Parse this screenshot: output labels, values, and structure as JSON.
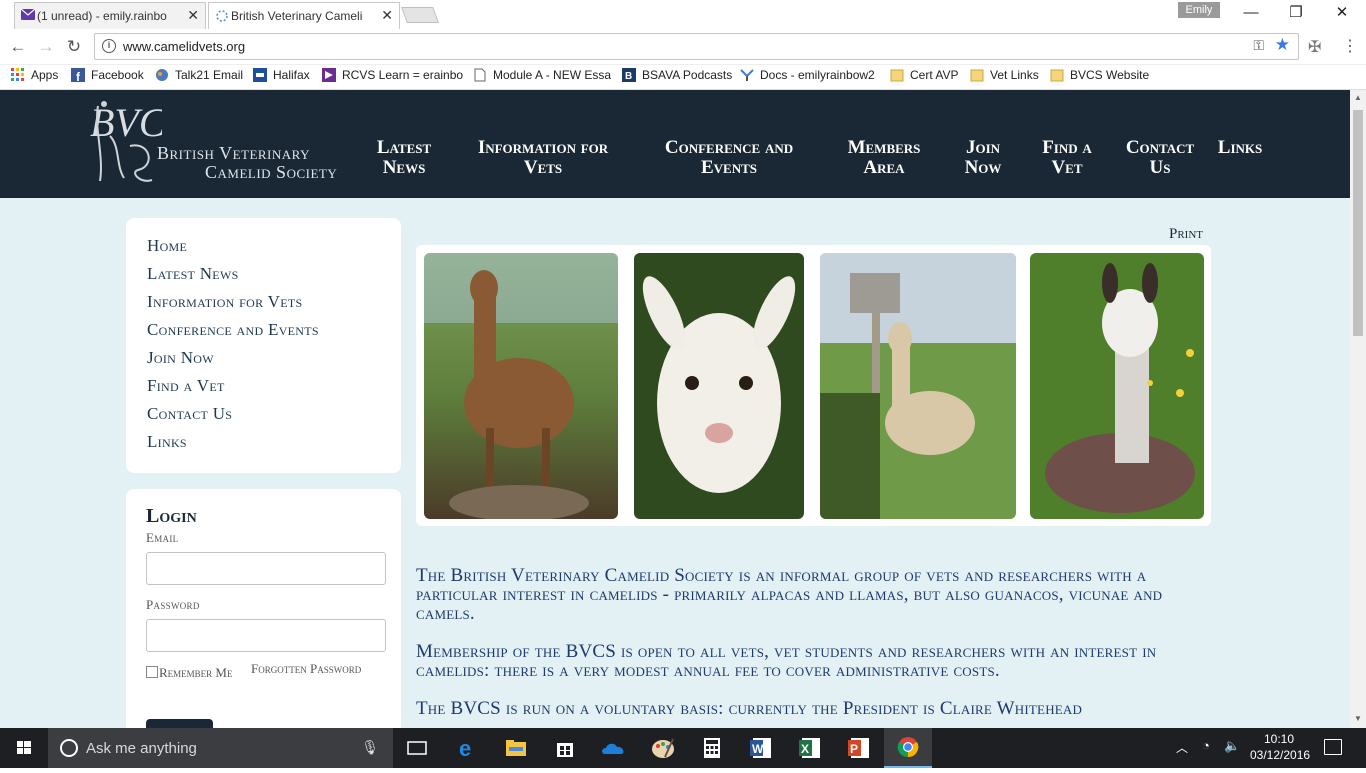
{
  "browser": {
    "tabs": [
      {
        "title": "(1 unread) - emily.rainbo",
        "icon": "yahoo-mail-icon"
      },
      {
        "title": "British Veterinary Camelic",
        "icon": "loading-spinner-icon"
      }
    ],
    "profile_name": "Emily",
    "url": "www.camelidvets.org",
    "bookmarks": [
      {
        "label": "Apps",
        "icon": "apps-grid-icon"
      },
      {
        "label": "Facebook",
        "icon": "facebook-icon"
      },
      {
        "label": "Talk21 Email",
        "icon": "talk21-icon"
      },
      {
        "label": "Halifax",
        "icon": "halifax-icon"
      },
      {
        "label": "RCVS Learn = erainbo",
        "icon": "rcvs-icon"
      },
      {
        "label": "Module A - NEW Essa",
        "icon": "page-icon"
      },
      {
        "label": "BSAVA Podcasts",
        "icon": "bsava-icon"
      },
      {
        "label": "Docs - emilyrainbow2",
        "icon": "docs-icon"
      },
      {
        "label": "Cert AVP",
        "icon": "folder-icon"
      },
      {
        "label": "Vet Links",
        "icon": "folder-icon"
      },
      {
        "label": "BVCS Website",
        "icon": "folder-icon"
      }
    ]
  },
  "site": {
    "logo_monogram": "BVCS",
    "logo_line1": "British Veterinary",
    "logo_line2": "Camelid Society",
    "nav": [
      {
        "line1": "Latest",
        "line2": "News"
      },
      {
        "line1": "Information for",
        "line2": "Vets"
      },
      {
        "line1": "Conference and",
        "line2": "Events"
      },
      {
        "line1": "Members",
        "line2": "Area"
      },
      {
        "line1": "Join",
        "line2": "Now"
      },
      {
        "line1": "Find a",
        "line2": "Vet"
      },
      {
        "line1": "Contact",
        "line2": "Us"
      },
      {
        "line1": "Links",
        "line2": ""
      }
    ],
    "sidebar": [
      "Home",
      "Latest News",
      "Information for Vets",
      "Conference and Events",
      "Join Now",
      "Find a Vet",
      "Contact Us",
      "Links"
    ],
    "login": {
      "title": "Login",
      "email_label": "Email",
      "password_label": "Password",
      "remember_label": "Remember Me",
      "forgot_label": "Forgotten Password"
    },
    "print_label": "Print",
    "paragraphs": [
      "The British Veterinary Camelid Society is an informal group of vets and researchers with a particular interest in camelids - primarily alpacas and llamas, but also guanacos, vicunae and camels.",
      "Membership of the BVCS is open to all vets, vet students and researchers with an interest in camelids: there is a very modest annual fee to cover administrative costs.",
      "The BVCS is run on a voluntary basis: currently the President is Claire Whitehead"
    ],
    "colors": {
      "header_bg": "#1a2836",
      "page_bg": "#e3f0f4",
      "body_text": "#1e3a6e"
    }
  },
  "taskbar": {
    "search_placeholder": "Ask me anything",
    "apps": [
      "task-view-icon",
      "edge-icon",
      "file-explorer-icon",
      "store-icon",
      "onedrive-icon",
      "paint-icon",
      "calculator-icon",
      "word-icon",
      "excel-icon",
      "powerpoint-icon",
      "chrome-icon"
    ],
    "time": "10:10",
    "date": "03/12/2016"
  }
}
